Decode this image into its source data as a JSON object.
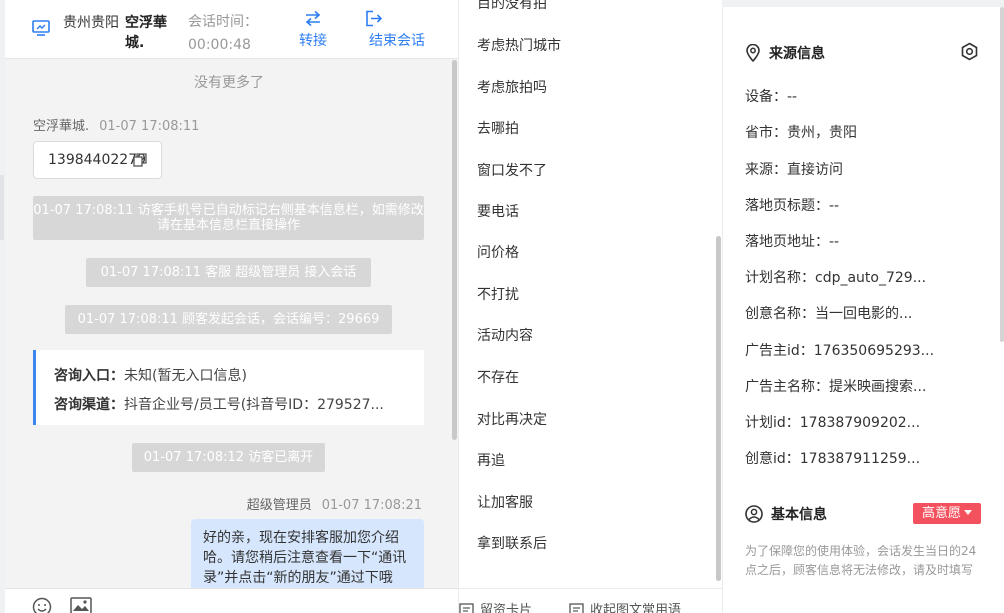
{
  "chat": {
    "header": {
      "location": "贵州贵阳",
      "visitor_name": "空浮華城.",
      "session_time_label": "会话时间：",
      "session_time_value": "00:00:48",
      "transfer_label": "转接",
      "end_label": "结束会话"
    },
    "no_more": "没有更多了",
    "messages": {
      "visitor_sender": "空浮華城.",
      "visitor_time": "01-07 17:08:11",
      "visitor_phone": "13984402279",
      "sys_1": "01-07 17:08:11 访客手机号已自动标记右侧基本信息栏，如需修改请在基本信息栏直接操作",
      "sys_2": "01-07 17:08:11 客服 超级管理员 接入会话",
      "sys_3": "01-07 17:08:11 顾客发起会话，会话编号：29669",
      "entry_label": "咨询入口：",
      "entry_value": "未知(暂无入口信息)",
      "channel_label": "咨询渠道：",
      "channel_value": "抖音企业号/员工号(抖音号ID：279527...",
      "sys_4": "01-07 17:08:12 访客已离开",
      "agent_sender": "超级管理员",
      "agent_time": "01-07 17:08:21",
      "agent_text": "好的亲，现在安排客服加您介绍哈。请您稍后注意查看一下“通讯录”并点击“新的朋友”通过下哦"
    }
  },
  "quick_replies": {
    "items": [
      "目的没有拍",
      "考虑热门城市",
      "考虑旅拍吗",
      "去哪拍",
      "窗口发不了",
      "要电话",
      "问价格",
      "不打扰",
      "活动内容",
      "不存在",
      "对比再决定",
      "再追",
      "让加客服",
      "拿到联系后"
    ],
    "footer_card": "留资卡片",
    "footer_collapse": "收起图文常用语"
  },
  "info": {
    "source_title": "来源信息",
    "rows": [
      "设备：--",
      "省市：贵州，贵阳",
      "来源：直接访问",
      "落地页标题：--",
      "落地页地址：--",
      "计划名称：cdp_auto_729...",
      "创意名称：当一回电影的...",
      "广告主id：176350695293...",
      "广告主名称：提米映画搜索...",
      "计划id：178387909202...",
      "创意id：178387911259..."
    ],
    "basic_title": "基本信息",
    "intent_badge": "高意愿",
    "notice": "为了保障您的使用体验，会话发生当日的24点之后，顾客信息将无法修改，请及时填写"
  },
  "colors": {
    "accent": "#2d7ef2",
    "badge": "#f4515e",
    "agent_bubble": "#d6e6fd",
    "system_msg": "#d7d7d8"
  }
}
